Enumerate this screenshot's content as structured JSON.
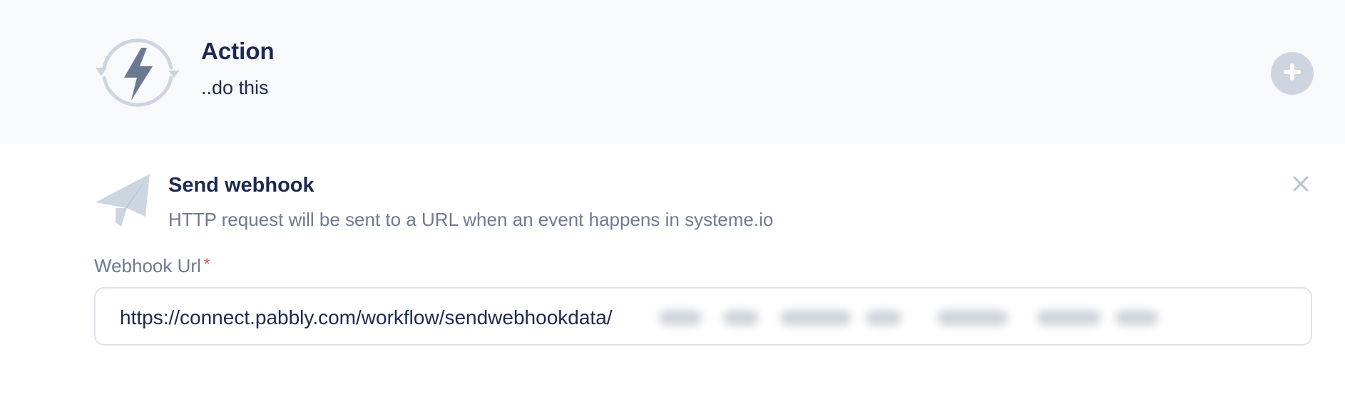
{
  "action_header": {
    "title": "Action",
    "subtitle": "..do this",
    "icon": "bolt-cycle-icon",
    "add_icon": "plus-icon"
  },
  "send_webhook": {
    "title": "Send webhook",
    "description": "HTTP request will be sent to a URL when an event happens in systeme.io",
    "icon": "paper-plane-icon",
    "close_icon": "close-icon"
  },
  "webhook_url": {
    "label": "Webhook Url",
    "required_mark": "*",
    "value": "https://connect.pabbly.com/workflow/sendwebhookdata/"
  },
  "colors": {
    "header_bg": "#f8f9fb",
    "title": "#1b2a52",
    "muted": "#6d7a91",
    "icon_gray": "#cdd5e0",
    "required": "#e5484d"
  }
}
